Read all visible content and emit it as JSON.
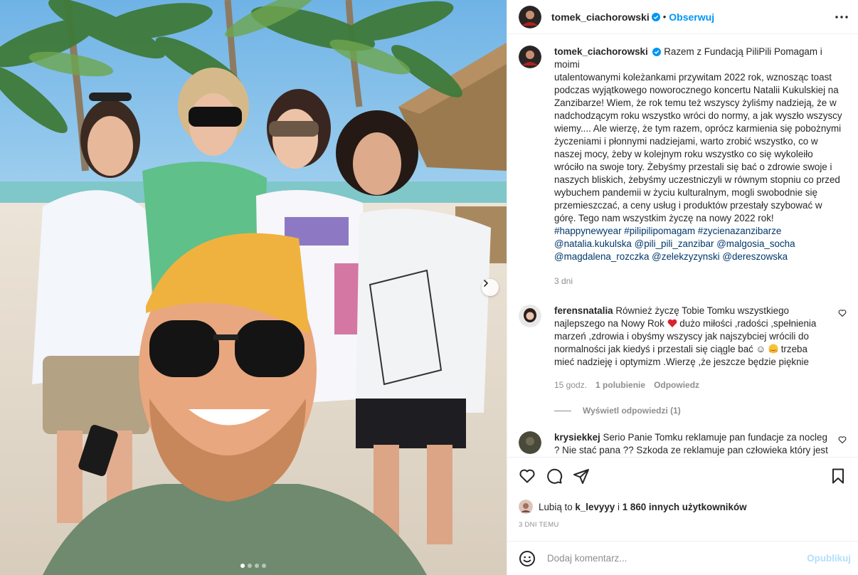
{
  "post": {
    "author": "tomek_ciachorowski",
    "follow_label": "Obserwuj",
    "separator": "•",
    "caption_lines": [
      "Razem z Fundacją PiliPili Pomagam i moimi",
      "utalentowanymi koleżankami przywitam 2022 rok, wznosząc toast",
      "podczas wyjątkowego noworocznego koncertu Natalii Kukulskiej na",
      "Zanzibarze! Wiem, że rok temu też wszyscy żyliśmy nadzieją, że w",
      "nadchodzącym roku wszystko wróci do normy, a jak wyszło wszyscy",
      "wiemy.... Ale wierzę, że tym razem, oprócz karmienia się pobożnymi",
      "życzeniami i płonnymi nadziejami, warto zrobić wszystko, co w",
      "naszej mocy, żeby w kolejnym roku wszystko co się wykoleiło",
      "wróciło na swoje tory. Żebyśmy przestali się bać o zdrowie swoje i",
      "naszych bliskich, żebyśmy uczestniczyli w równym stopniu co przed",
      "wybuchem pandemii w życiu kulturalnym, mogli swobodnie się",
      "przemieszczać, a ceny usług i produktów przestały szybować w",
      "górę. Tego nam wszystkim życzę na nowy 2022 rok!"
    ],
    "hashtags": [
      "#happynewyear",
      "#pilipilipomagam",
      "#zycienazanzibarze"
    ],
    "mentions_line1": [
      "@natalia.kukulska",
      "@pili_pili_zanzibar",
      "@malgosia_socha"
    ],
    "mentions_line2": [
      "@magdalena_rozczka",
      "@zelekzyzynski",
      "@dereszowska"
    ],
    "caption_time": "3 dni"
  },
  "comments": [
    {
      "user": "ferensnatalia",
      "line1": "Również życzę Tobie Tomku wszystkiego",
      "line2a": "najlepszego na Nowy Rok",
      "line2b": "dużo miłości ,radości ,spełnienia",
      "line3": "marzeń ,zdrowia i obyśmy wszyscy jak najszybciej wrócili do",
      "line4a": "normalności jak kiedyś i przestali się ciągle bać ☺",
      "line4b": "trzeba",
      "line5": "mieć nadzieję i optymizm .Wierzę ,że jeszcze będzie pięknie",
      "time": "15 godz.",
      "likes": "1 polubienie",
      "reply": "Odpowiedz",
      "view_replies": "Wyświetl odpowiedzi (1)"
    },
    {
      "user": "krysiekkej",
      "line1": "Serio Panie Tomku reklamuje pan fundacje za nocleg",
      "line2": "? Nie stać pana ?? Szkoda ze reklamuje pan człowieka który jest"
    }
  ],
  "likes": {
    "prefix": "Lubią to",
    "user": "k_levyyy",
    "conj": "i",
    "others": "1 860 innych użytkowników"
  },
  "time_ago": "3 DNI TEMU",
  "comment_input": {
    "placeholder": "Dodaj komentarz...",
    "publish": "Opublikuj"
  },
  "colors": {
    "link": "#00376b",
    "accent": "#0095f6",
    "muted": "#8e8e8e",
    "verified": "#0095f6",
    "heart": "#ed4956"
  },
  "carousel": {
    "total": 4,
    "active": 1
  }
}
